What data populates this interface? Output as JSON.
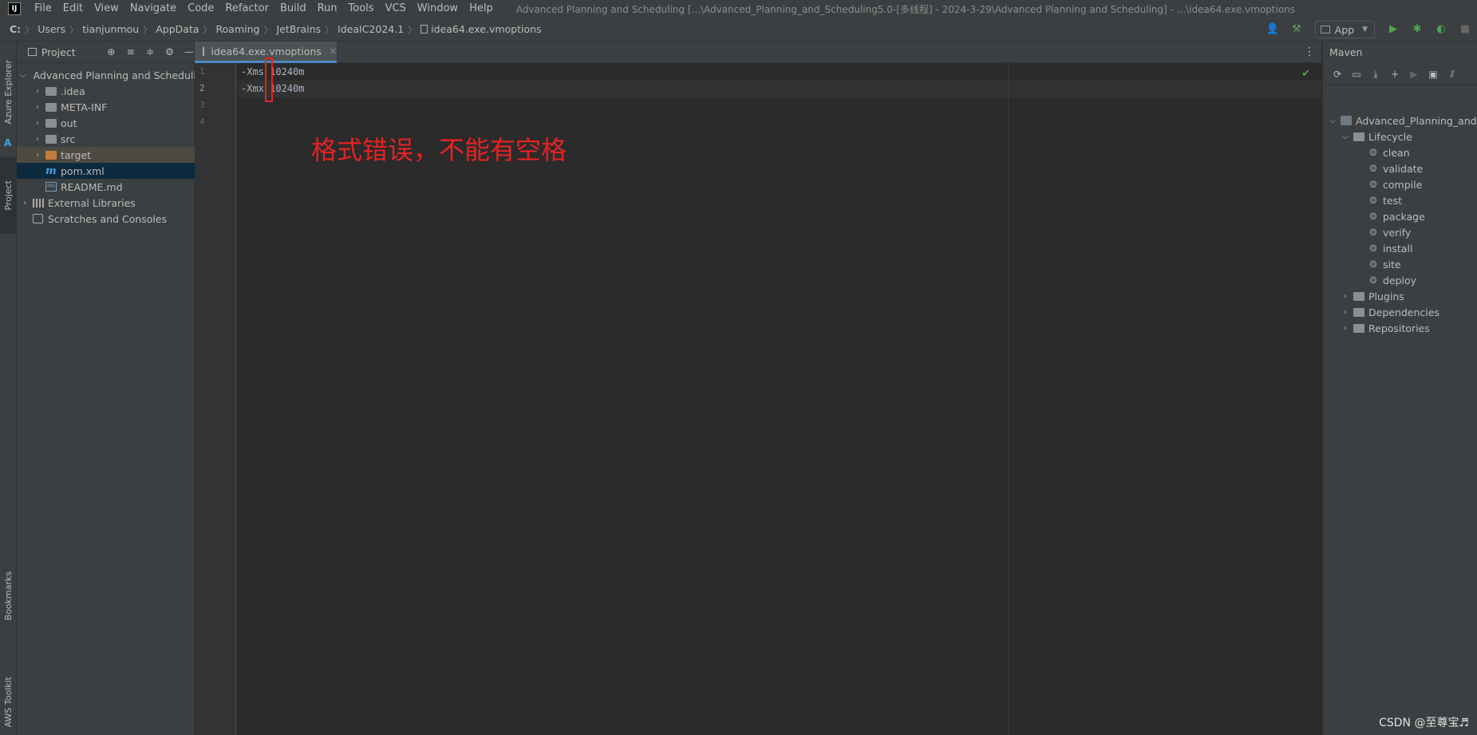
{
  "menubar": {
    "logo": "IJ",
    "items": [
      "File",
      "Edit",
      "View",
      "Navigate",
      "Code",
      "Refactor",
      "Build",
      "Run",
      "Tools",
      "VCS",
      "Window",
      "Help"
    ],
    "window_title": "Advanced Planning and Scheduling [...\\Advanced_Planning_and_Scheduling5.0-[多线程] - 2024-3-29\\Advanced Planning and Scheduling] - ...\\idea64.exe.vmoptions"
  },
  "navbar": {
    "breadcrumbs": [
      "C:",
      "Users",
      "tianjunmou",
      "AppData",
      "Roaming",
      "JetBrains",
      "IdeaIC2024.1",
      "idea64.exe.vmoptions"
    ],
    "run_config": "App"
  },
  "left_stripe": {
    "azure": "Azure Explorer",
    "project": "Project",
    "bookmarks": "Bookmarks",
    "aws": "AWS Toolkit"
  },
  "project_panel": {
    "title": "Project",
    "tree": [
      {
        "label": "Advanced Planning and Scheduling",
        "type": "module",
        "expanded": true
      },
      {
        "label": ".idea",
        "type": "folder"
      },
      {
        "label": "META-INF",
        "type": "folder"
      },
      {
        "label": "out",
        "type": "folder"
      },
      {
        "label": "src",
        "type": "folder"
      },
      {
        "label": "target",
        "type": "folder-excluded"
      },
      {
        "label": "pom.xml",
        "type": "maven"
      },
      {
        "label": "README.md",
        "type": "markdown"
      },
      {
        "label": "External Libraries",
        "type": "library"
      },
      {
        "label": "Scratches and Consoles",
        "type": "scratch"
      }
    ]
  },
  "editor": {
    "tab_label": "idea64.exe.vmoptions",
    "line_numbers": [
      "1",
      "2",
      "3",
      "4"
    ],
    "lines": [
      "-Xms 10240m",
      "-Xmx 10240m",
      "",
      ""
    ],
    "annotation": "格式错误，不能有空格",
    "annotation_color": "#e62222"
  },
  "maven_panel": {
    "title": "Maven",
    "project": "Advanced_Planning_and_Scheduling",
    "lifecycle_label": "Lifecycle",
    "lifecycle": [
      "clean",
      "validate",
      "compile",
      "test",
      "package",
      "verify",
      "install",
      "site",
      "deploy"
    ],
    "groups": [
      "Plugins",
      "Dependencies",
      "Repositories"
    ]
  },
  "watermark": "CSDN @至尊宝♬"
}
